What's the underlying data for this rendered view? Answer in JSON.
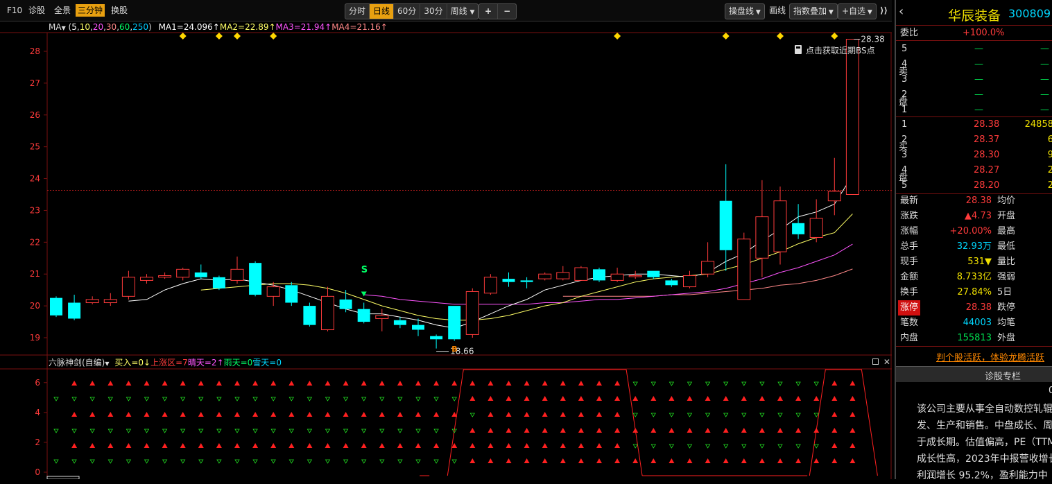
{
  "toolbar": {
    "left_items": [
      "F10",
      "诊股",
      "全景",
      "三分钟",
      "换股"
    ],
    "active_left": "三分钟",
    "periods": [
      "分时",
      "日线",
      "60分",
      "30分",
      "周线"
    ],
    "active_period": "日线",
    "zoom_in": "+",
    "zoom_out": "−",
    "right_items": [
      "操盘线",
      "画线",
      "指数叠加",
      "+自选"
    ]
  },
  "ma_legend": {
    "label": "MA",
    "params_prefix": "(",
    "params": [
      "5",
      "10",
      "20",
      "30",
      "60",
      "250"
    ],
    "params_suffix": ")",
    "ma1": "MA1=24.096↑",
    "ma2": "MA2=22.89↑",
    "ma3": "MA3=21.94↑",
    "ma4": "MA4=21.16↑"
  },
  "lock_tip": "点击获取近期BS点",
  "price_marks": {
    "high": "28.38",
    "low": "18.66"
  },
  "signals": {
    "buy": "B",
    "sell": "S"
  },
  "indicator": {
    "name": "六脉神剑(自编)",
    "buy_in": "买入=0↓",
    "up_zone": "上涨区=7",
    "sunny": "晴天=2↑",
    "rainy": "雨天=0",
    "snowy": "雪天=0",
    "axis": [
      "6",
      "4",
      "2",
      "0"
    ]
  },
  "colors": {
    "up": "#ff3b3b",
    "down": "#00ffff",
    "ma5": "#ffffff",
    "ma10": "#ffff66",
    "ma20": "#ff55ff",
    "ma30": "#ff8888",
    "grid": "#7a1010",
    "diamond": "#ffd700"
  },
  "chart_data": {
    "type": "candlestick",
    "y_axis": {
      "min": 18.5,
      "max": 28.5,
      "ticks": [
        19,
        20,
        21,
        22,
        23,
        24,
        25,
        26,
        27,
        28
      ]
    },
    "candles": [
      {
        "o": 20.25,
        "c": 19.7,
        "h": 20.3,
        "l": 19.65
      },
      {
        "o": 20.1,
        "c": 19.6,
        "h": 20.35,
        "l": 19.55
      },
      {
        "o": 20.1,
        "c": 20.2,
        "h": 20.3,
        "l": 20.05
      },
      {
        "o": 20.1,
        "c": 20.2,
        "h": 20.4,
        "l": 20.0
      },
      {
        "o": 20.3,
        "c": 20.9,
        "h": 21.1,
        "l": 20.2
      },
      {
        "o": 20.8,
        "c": 20.9,
        "h": 21.0,
        "l": 20.7
      },
      {
        "o": 20.9,
        "c": 20.95,
        "h": 21.05,
        "l": 20.85
      },
      {
        "o": 20.9,
        "c": 21.15,
        "h": 21.2,
        "l": 20.8
      },
      {
        "o": 21.05,
        "c": 20.9,
        "h": 21.3,
        "l": 20.85
      },
      {
        "o": 20.9,
        "c": 20.55,
        "h": 20.95,
        "l": 20.5
      },
      {
        "o": 20.8,
        "c": 21.15,
        "h": 21.55,
        "l": 20.7
      },
      {
        "o": 21.35,
        "c": 20.35,
        "h": 21.4,
        "l": 20.3
      },
      {
        "o": 20.3,
        "c": 20.6,
        "h": 20.75,
        "l": 20.0
      },
      {
        "o": 20.65,
        "c": 20.1,
        "h": 20.75,
        "l": 20.0
      },
      {
        "o": 20.0,
        "c": 19.4,
        "h": 20.1,
        "l": 19.35
      },
      {
        "o": 19.25,
        "c": 20.3,
        "h": 20.6,
        "l": 19.2
      },
      {
        "o": 20.2,
        "c": 19.9,
        "h": 20.5,
        "l": 19.8
      },
      {
        "o": 19.9,
        "c": 19.5,
        "h": 20.1,
        "l": 19.45
      },
      {
        "o": 19.6,
        "c": 19.7,
        "h": 19.9,
        "l": 19.2
      },
      {
        "o": 19.55,
        "c": 19.4,
        "h": 19.65,
        "l": 19.3
      },
      {
        "o": 19.4,
        "c": 19.25,
        "h": 19.6,
        "l": 19.05
      },
      {
        "o": 19.05,
        "c": 18.95,
        "h": 19.1,
        "l": 18.66
      },
      {
        "o": 20.0,
        "c": 18.95,
        "h": 20.0,
        "l": 18.9
      },
      {
        "o": 19.1,
        "c": 20.45,
        "h": 20.55,
        "l": 19.0
      },
      {
        "o": 20.4,
        "c": 20.9,
        "h": 21.0,
        "l": 20.35
      },
      {
        "o": 20.85,
        "c": 20.75,
        "h": 21.05,
        "l": 20.6
      },
      {
        "o": 20.8,
        "c": 20.75,
        "h": 20.9,
        "l": 20.55
      },
      {
        "o": 20.85,
        "c": 21.0,
        "h": 21.05,
        "l": 20.8
      },
      {
        "o": 20.85,
        "c": 21.05,
        "h": 21.25,
        "l": 20.8
      },
      {
        "o": 20.8,
        "c": 21.2,
        "h": 21.25,
        "l": 20.8
      },
      {
        "o": 21.15,
        "c": 20.8,
        "h": 21.2,
        "l": 20.75
      },
      {
        "o": 20.8,
        "c": 21.0,
        "h": 21.2,
        "l": 20.75
      },
      {
        "o": 20.95,
        "c": 20.95,
        "h": 21.1,
        "l": 20.85
      },
      {
        "o": 21.1,
        "c": 20.9,
        "h": 21.1,
        "l": 20.85
      },
      {
        "o": 20.8,
        "c": 20.65,
        "h": 20.85,
        "l": 20.6
      },
      {
        "o": 20.6,
        "c": 20.95,
        "h": 21.1,
        "l": 20.55
      },
      {
        "o": 21.0,
        "c": 21.4,
        "h": 22.0,
        "l": 20.9
      },
      {
        "o": 23.3,
        "c": 21.75,
        "h": 24.45,
        "l": 21.1
      },
      {
        "o": 20.2,
        "c": 22.1,
        "h": 22.3,
        "l": 20.2
      },
      {
        "o": 21.5,
        "c": 22.8,
        "h": 23.95,
        "l": 20.9
      },
      {
        "o": 21.7,
        "c": 23.3,
        "h": 23.75,
        "l": 21.3
      },
      {
        "o": 22.6,
        "c": 22.25,
        "h": 23.2,
        "l": 22.1
      },
      {
        "o": 22.15,
        "c": 22.75,
        "h": 23.35,
        "l": 22.0
      },
      {
        "o": 23.3,
        "c": 23.6,
        "h": 24.65,
        "l": 22.85
      },
      {
        "o": 23.5,
        "c": 28.38,
        "h": 28.38,
        "l": 23.5
      }
    ],
    "ma5": [
      null,
      null,
      null,
      null,
      20.15,
      20.2,
      20.5,
      20.7,
      20.85,
      20.8,
      20.85,
      20.75,
      20.65,
      20.5,
      20.3,
      20.1,
      19.9,
      19.75,
      19.75,
      19.65,
      19.55,
      19.4,
      19.3,
      19.5,
      19.75,
      20.0,
      20.2,
      20.5,
      20.65,
      20.8,
      20.9,
      20.95,
      21.0,
      21.0,
      20.95,
      20.9,
      21.05,
      21.4,
      21.65,
      22.05,
      22.4,
      22.8,
      22.95,
      23.2,
      24.1
    ],
    "ma10": [
      null,
      null,
      null,
      null,
      null,
      null,
      null,
      null,
      20.5,
      20.55,
      20.6,
      20.65,
      20.7,
      20.7,
      20.65,
      20.55,
      20.4,
      20.2,
      20.0,
      19.85,
      19.7,
      19.6,
      19.55,
      19.55,
      19.6,
      19.7,
      19.85,
      20.0,
      20.1,
      20.3,
      20.45,
      20.6,
      20.75,
      20.85,
      20.9,
      20.95,
      21.0,
      21.15,
      21.3,
      21.5,
      21.7,
      21.95,
      22.15,
      22.3,
      22.89
    ],
    "ma20": [
      null,
      null,
      null,
      null,
      null,
      null,
      null,
      null,
      null,
      null,
      null,
      null,
      null,
      null,
      null,
      null,
      null,
      20.35,
      20.3,
      20.2,
      20.15,
      20.1,
      20.05,
      20.05,
      20.05,
      20.05,
      20.05,
      20.1,
      20.1,
      20.15,
      20.2,
      20.2,
      20.25,
      20.3,
      20.35,
      20.4,
      20.45,
      20.55,
      20.7,
      20.85,
      21.05,
      21.2,
      21.4,
      21.6,
      21.94
    ],
    "ma30": [
      null,
      null,
      null,
      null,
      null,
      null,
      null,
      null,
      null,
      null,
      null,
      null,
      null,
      null,
      null,
      null,
      null,
      null,
      null,
      null,
      null,
      null,
      null,
      null,
      null,
      null,
      null,
      null,
      20.3,
      20.3,
      20.3,
      20.3,
      20.3,
      20.3,
      20.35,
      20.35,
      20.4,
      20.45,
      20.5,
      20.55,
      20.65,
      20.7,
      20.8,
      20.95,
      21.16
    ],
    "diamond_candles": [
      7,
      9,
      10,
      12,
      31,
      37,
      40,
      43
    ],
    "sell_signal_candle": 17,
    "buy_signal_candle": 22,
    "indicator_up_ranges": [
      [
        23,
        31
      ],
      [
        43,
        44
      ]
    ],
    "indicator_rows": [
      6,
      5,
      4,
      3,
      2,
      1
    ]
  },
  "stock": {
    "name": "华辰装备",
    "code": "300809"
  },
  "weibi": {
    "label": "委比",
    "value": "+100.0%"
  },
  "sell_side_label": [
    "卖",
    "盘"
  ],
  "buy_side_label": [
    "买",
    "盘"
  ],
  "asks": [
    {
      "level": "5",
      "price": "—",
      "vol": "—"
    },
    {
      "level": "4",
      "price": "—",
      "vol": "—"
    },
    {
      "level": "3",
      "price": "—",
      "vol": "—"
    },
    {
      "level": "2",
      "price": "—",
      "vol": "—"
    },
    {
      "level": "1",
      "price": "—",
      "vol": "—"
    }
  ],
  "bids": [
    {
      "level": "1",
      "price": "28.38",
      "vol": "24858"
    },
    {
      "level": "2",
      "price": "28.37",
      "vol": "6"
    },
    {
      "level": "3",
      "price": "28.30",
      "vol": "9"
    },
    {
      "level": "4",
      "price": "28.27",
      "vol": "2"
    },
    {
      "level": "5",
      "price": "28.20",
      "vol": "2"
    }
  ],
  "stats": [
    {
      "label": "最新",
      "value": "28.38",
      "label2": "均价"
    },
    {
      "label": "涨跌",
      "value": "▲4.73",
      "label2": "开盘"
    },
    {
      "label": "涨幅",
      "value": "+20.00%",
      "label2": "最高"
    },
    {
      "label": "总手",
      "value": "32.93万",
      "label2": "最低"
    },
    {
      "label": "现手",
      "value": "531▼",
      "label2": "量比"
    },
    {
      "label": "金额",
      "value": "8.733亿",
      "label2": "强弱"
    },
    {
      "label": "换手",
      "value": "27.84%",
      "label2": "5日"
    },
    {
      "label": "涨停",
      "value": "28.38",
      "label2": "跌停"
    },
    {
      "label": "笔数",
      "value": "44003",
      "label2": "均笔"
    },
    {
      "label": "内盘",
      "value": "155813",
      "label2": "外盘"
    }
  ],
  "promo": "判个股活跃，体验龙腾活跃",
  "diag_title": "诊股专栏",
  "diag_num": "0",
  "diag_lines": [
    "该公司主要从事全自动数控轧辊",
    "发、生产和销售。中盘成长、周",
    "于成长期。估值偏高，PE（TTM",
    "成长性高，2023年中报营收增长",
    "利润增长 95.2%，盈利能力中"
  ]
}
